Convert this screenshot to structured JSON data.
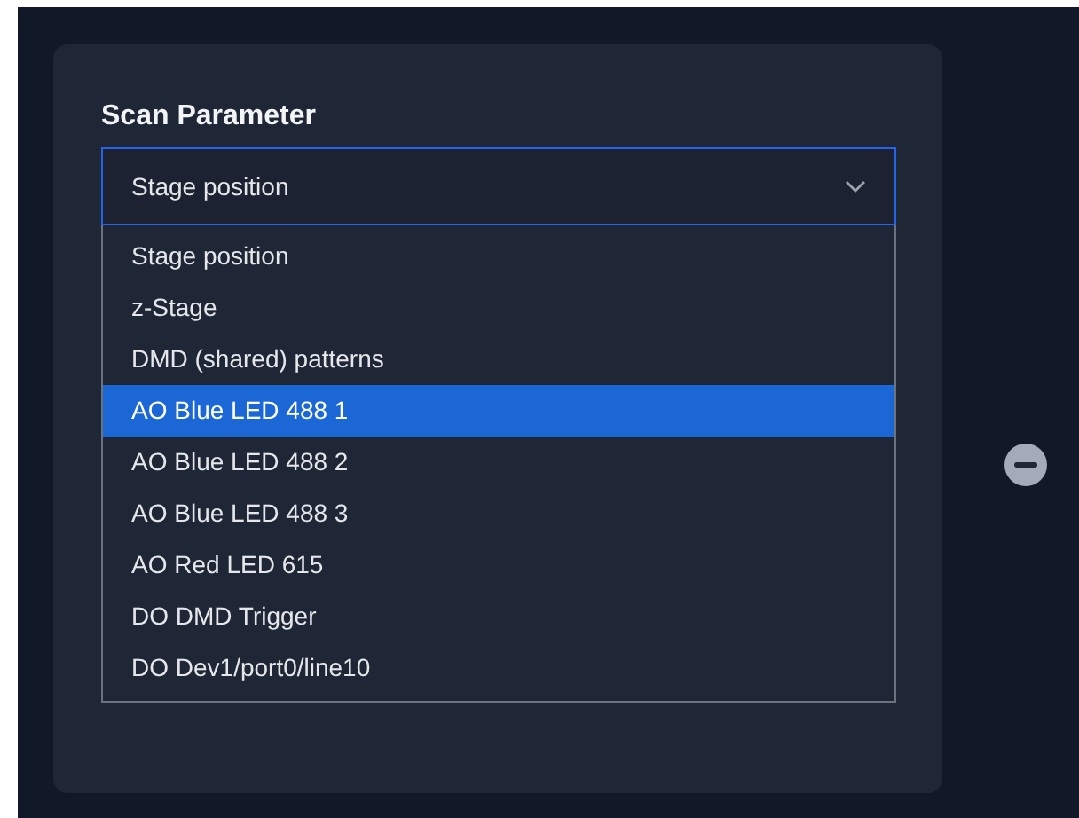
{
  "panel": {
    "title": "Scan Parameter",
    "select": {
      "value": "Stage position",
      "expanded": true,
      "options": [
        {
          "label": "Stage position",
          "highlighted": false
        },
        {
          "label": "z-Stage",
          "highlighted": false
        },
        {
          "label": "DMD (shared) patterns",
          "highlighted": false
        },
        {
          "label": "AO Blue LED 488 1",
          "highlighted": true
        },
        {
          "label": "AO Blue LED 488 2",
          "highlighted": false
        },
        {
          "label": "AO Blue LED 488 3",
          "highlighted": false
        },
        {
          "label": "AO Red LED 615",
          "highlighted": false
        },
        {
          "label": "DO DMD Trigger",
          "highlighted": false
        },
        {
          "label": "DO Dev1/port0/line10",
          "highlighted": false
        }
      ]
    }
  }
}
